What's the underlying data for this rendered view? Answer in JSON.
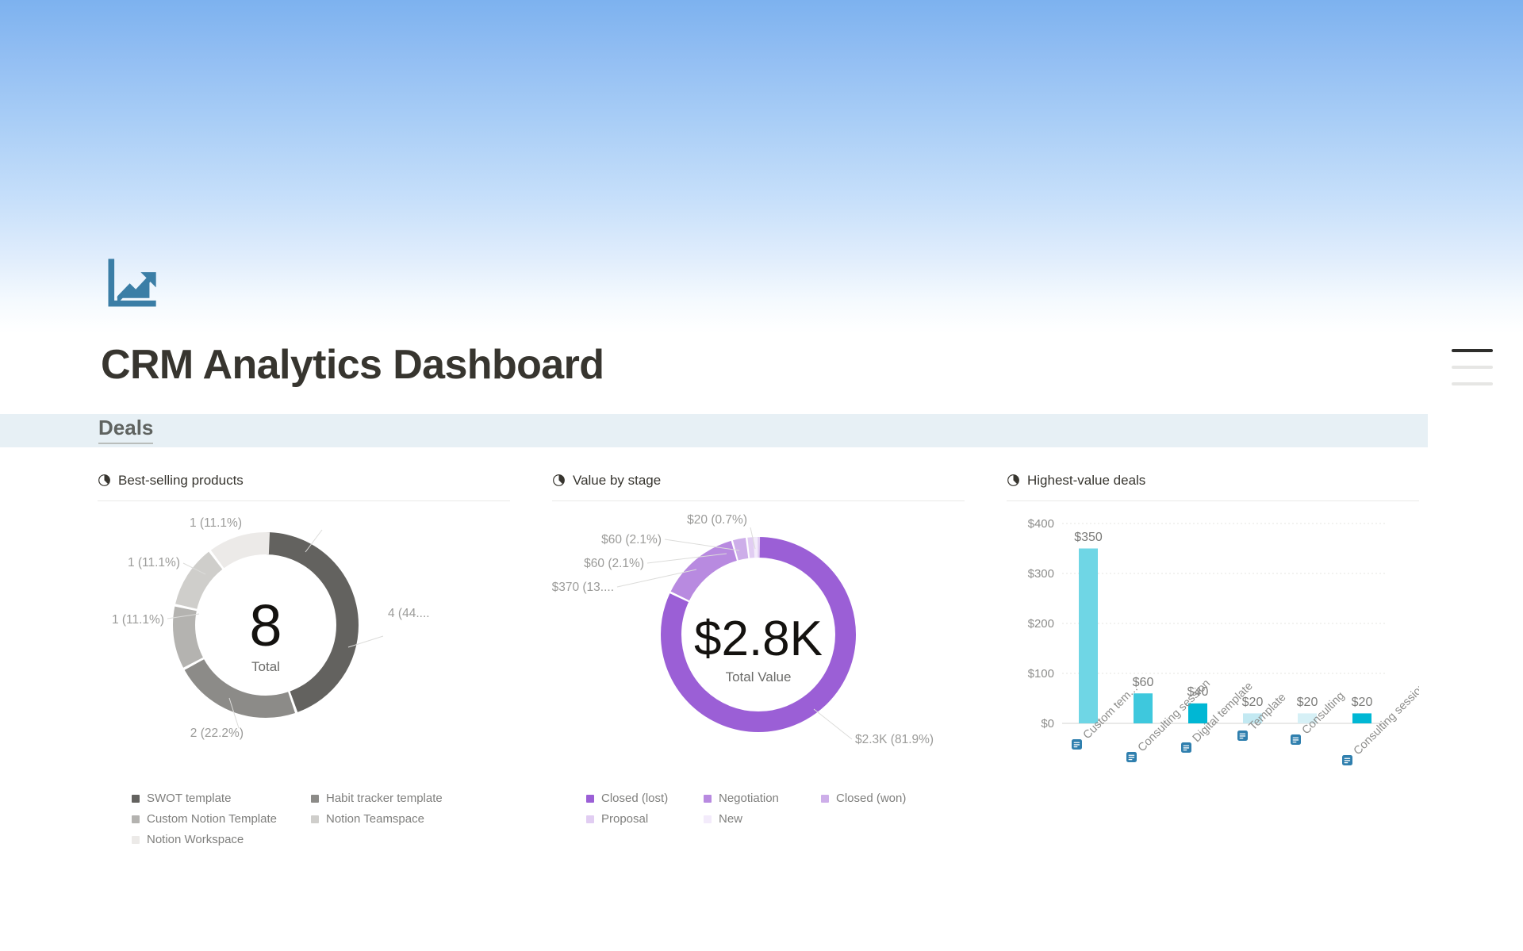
{
  "page": {
    "title": "CRM Analytics Dashboard",
    "icon": "chart-increasing-icon",
    "icon_color": "#3b7ea6",
    "background_gradient": [
      "#7db2ef",
      "#ffffff"
    ]
  },
  "toc": {
    "items": [
      "Deals",
      "",
      ""
    ],
    "active_index": 0
  },
  "section": {
    "label": "Deals",
    "band_color": "#e7f0f5"
  },
  "cards": [
    {
      "title": "Best-selling products",
      "icon": "pie-chart-icon"
    },
    {
      "title": "Value by stage",
      "icon": "pie-chart-icon"
    },
    {
      "title": "Highest-value deals",
      "icon": "pie-chart-icon"
    }
  ],
  "chart_data": [
    {
      "type": "pie",
      "title": "Best-selling products",
      "center_value": "8",
      "center_label": "Total",
      "legend_position": "bottom",
      "labels": [
        "SWOT template",
        "Habit tracker template",
        "Custom Notion Template",
        "Notion Teamspace",
        "Notion Workspace"
      ],
      "values": [
        4,
        2,
        1,
        1,
        1
      ],
      "value_labels": [
        "4 (44....",
        "2 (22.2%)",
        "1 (11.1%)",
        "1 (11.1%)",
        "1 (11.1%)"
      ],
      "percents": [
        44.4,
        22.2,
        11.1,
        11.1,
        11.1
      ],
      "colors": [
        "#63625f",
        "#8c8b88",
        "#b4b3b0",
        "#cfcecb",
        "#eceae8"
      ],
      "legend": [
        {
          "label": "SWOT template",
          "color": "#63625f"
        },
        {
          "label": "Habit tracker template",
          "color": "#8c8b88"
        },
        {
          "label": "Custom Notion Template",
          "color": "#b4b3b0"
        },
        {
          "label": "Notion Teamspace",
          "color": "#cfcecb"
        },
        {
          "label": "Notion Workspace",
          "color": "#eceae8"
        }
      ]
    },
    {
      "type": "pie",
      "title": "Value by stage",
      "center_value": "$2.8K",
      "center_label": "Total Value",
      "legend_position": "bottom",
      "labels": [
        "Closed (lost)",
        "Negotiation",
        "Closed (won)",
        "Proposal",
        "New"
      ],
      "values": [
        2300,
        370,
        60,
        60,
        20
      ],
      "value_labels": [
        "$2.3K (81.9%)",
        "$370 (13....",
        "$60 (2.1%)",
        "$60 (2.1%)",
        "$20 (0.7%)"
      ],
      "percents": [
        81.9,
        13.2,
        2.1,
        2.1,
        0.7
      ],
      "colors": [
        "#9b5fd6",
        "#b88ae0",
        "#cdaee9",
        "#e1cdf2",
        "#f3ebfb"
      ],
      "legend": [
        {
          "label": "Closed (lost)",
          "color": "#9b5fd6"
        },
        {
          "label": "Negotiation",
          "color": "#b88ae0"
        },
        {
          "label": "Closed (won)",
          "color": "#cdaee9"
        },
        {
          "label": "Proposal",
          "color": "#e1cdf2"
        },
        {
          "label": "New",
          "color": "#f3ebfb"
        }
      ]
    },
    {
      "type": "bar",
      "title": "Highest-value deals",
      "categories": [
        "Custom tem...",
        "Consulting session",
        "Digital template",
        "Template",
        "Consulting",
        "Consulting session"
      ],
      "values": [
        350,
        60,
        40,
        20,
        20,
        20
      ],
      "bar_labels": [
        "$350",
        "$60",
        "$40",
        "$20",
        "$20",
        "$20"
      ],
      "colors": [
        "#6fd6e5",
        "#3ec8dd",
        "#00b7d4",
        "#c3e9f2",
        "#d6f0f6",
        "#00b7d4"
      ],
      "ylabel": "",
      "xlabel": "",
      "ylim": [
        0,
        400
      ],
      "yticks": [
        "$0",
        "$100",
        "$200",
        "$300",
        "$400"
      ],
      "ytick_values": [
        0,
        100,
        200,
        300,
        400
      ],
      "grid": true,
      "x_label_icon": "notion-page-icon"
    }
  ]
}
